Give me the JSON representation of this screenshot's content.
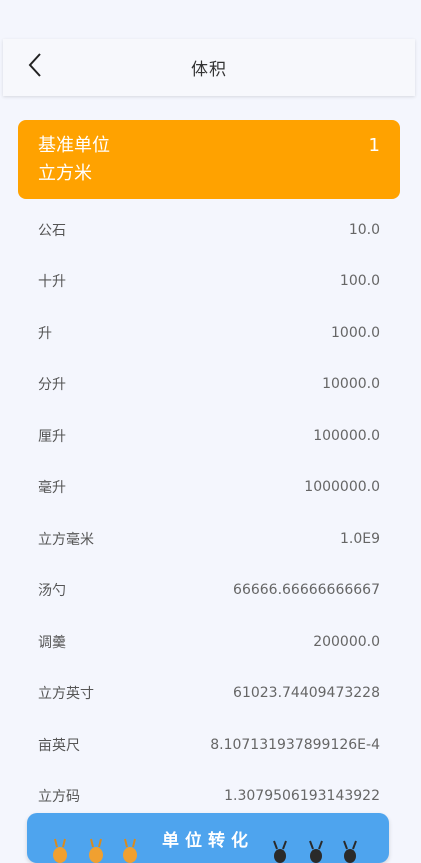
{
  "header": {
    "title": "体积",
    "back_icon": "chevron-left-icon"
  },
  "base": {
    "label": "基准单位",
    "value": "1",
    "unit": "立方米",
    "color": "#ffa200"
  },
  "units": [
    {
      "name": "公石",
      "value": "10.0"
    },
    {
      "name": "十升",
      "value": "100.0"
    },
    {
      "name": "升",
      "value": "1000.0"
    },
    {
      "name": "分升",
      "value": "10000.0"
    },
    {
      "name": "厘升",
      "value": "100000.0"
    },
    {
      "name": "毫升",
      "value": "1000000.0"
    },
    {
      "name": "立方毫米",
      "value": "1.0E9"
    },
    {
      "name": "汤勺",
      "value": "66666.66666666667"
    },
    {
      "name": "调羹",
      "value": "200000.0"
    },
    {
      "name": "立方英寸",
      "value": "61023.74409473228"
    },
    {
      "name": "亩英尺",
      "value": "8.107131937899126E-4"
    },
    {
      "name": "立方码",
      "value": "1.3079506193143922"
    }
  ],
  "convert_button": {
    "label": "单位转化",
    "color": "#4ea4ee"
  }
}
